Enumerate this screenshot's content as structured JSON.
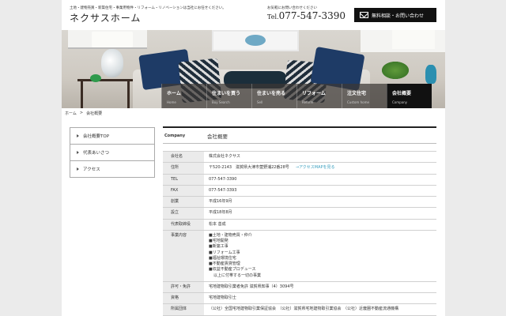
{
  "header": {
    "tagline": "土地・建物売買・新築住宅・事業用物件・リフォーム・リノベーションは当社にお任せください。",
    "logo": "ネクサスホーム",
    "tel_note": "お気軽にお問い合わせください",
    "tel_prefix": "Tel.",
    "tel_number": "077-547-3390",
    "contact_button": "無料相談・お問い合わせ"
  },
  "nav": [
    {
      "label": "ホーム",
      "sub": "Home"
    },
    {
      "label": "住まいを買う",
      "sub": "Buy Search"
    },
    {
      "label": "住まいを売る",
      "sub": "Sell"
    },
    {
      "label": "リフォーム",
      "sub": "Reform"
    },
    {
      "label": "注文住宅",
      "sub": "Custom home"
    },
    {
      "label": "会社概要",
      "sub": "Company"
    }
  ],
  "breadcrumb": {
    "home": "ホーム",
    "sep": ">",
    "current": "会社概要"
  },
  "sidebar": [
    "会社概要TOP",
    "代表あいさつ",
    "アクセス"
  ],
  "main": {
    "heading_en": "Company",
    "heading_jp": "会社概要"
  },
  "info": {
    "company_k": "会社名",
    "company_v": "株式会社ネクサス",
    "address_k": "住所",
    "address_v": "〒520-2143　滋賀県大津市萱野浦22番28号",
    "address_link": "→アクセスMAPを見る",
    "tel_k": "TEL",
    "tel_v": "077-547-3390",
    "fax_k": "FAX",
    "fax_v": "077-547-3393",
    "founded_k": "創業",
    "founded_v": "平成16年9月",
    "established_k": "設立",
    "established_v": "平成18年8月",
    "rep_k": "代表取締役",
    "rep_v": "松本 善成",
    "business_k": "事業内容",
    "business": [
      "■土地・建物売買・仲介",
      "■宅地開発",
      "■新築工事",
      "■リフォーム工事",
      "■福祉環境住宅",
      "■不動産賃貸管理",
      "■収益不動産プロデュース"
    ],
    "business_extra": "以上に付帯する一切の事業",
    "license_k": "許可・免許",
    "license_v": "宅地建物取引業者免許 滋賀県知事（4）3094号",
    "qual_k": "資格",
    "qual_v": "宅地建物取引士",
    "assoc_k": "所属団体",
    "assoc_v": "（公社）全国宅地建物取引業保証協会　（公社）滋賀県宅地建物取引業協会　（公社）近畿圏不動産流通機構"
  }
}
